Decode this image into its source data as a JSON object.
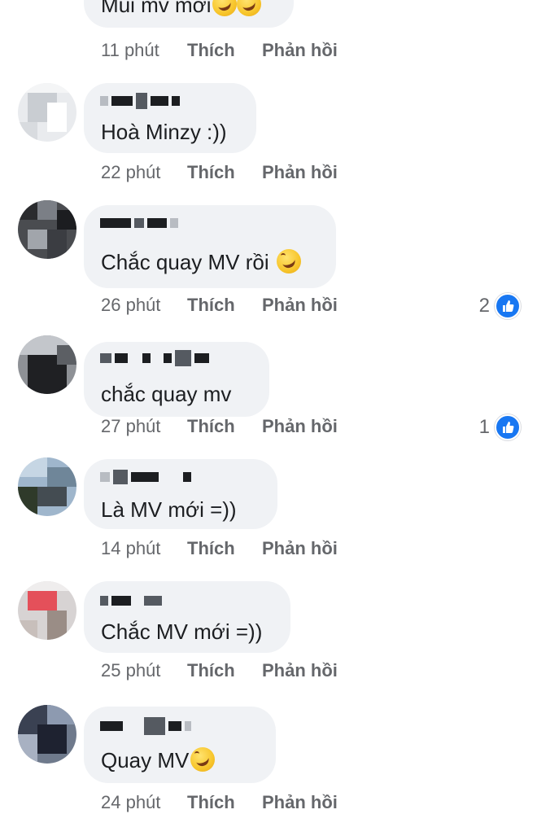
{
  "comments": [
    {
      "text": "Mùi mv mới",
      "emoji_count": 2,
      "time": "11 phút",
      "like": "Thích",
      "reply": "Phản hồi",
      "reactions": ""
    },
    {
      "text": "Hoà Minzy :))",
      "emoji_count": 0,
      "time": "22 phút",
      "like": "Thích",
      "reply": "Phản hồi",
      "reactions": ""
    },
    {
      "text": "Chắc quay MV rồi",
      "emoji_count": 1,
      "time": "26 phút",
      "like": "Thích",
      "reply": "Phản hồi",
      "reactions": "2"
    },
    {
      "text": "chắc quay mv",
      "emoji_count": 0,
      "time": "27 phút",
      "like": "Thích",
      "reply": "Phản hồi",
      "reactions": "1"
    },
    {
      "text": "Là MV mới =))",
      "emoji_count": 0,
      "time": "14 phút",
      "like": "Thích",
      "reply": "Phản hồi",
      "reactions": ""
    },
    {
      "text": "Chắc MV mới =))",
      "emoji_count": 0,
      "time": "25 phút",
      "like": "Thích",
      "reply": "Phản hồi",
      "reactions": ""
    },
    {
      "text": "Quay MV",
      "emoji_count": 1,
      "time": "24 phút",
      "like": "Thích",
      "reply": "Phản hồi",
      "reactions": ""
    }
  ],
  "colors": {
    "bubble": "#f0f2f5",
    "meta": "#65676b",
    "like_badge": "#1877f2"
  },
  "icons": {
    "emoji": "rolling-on-floor-laughing-emoji",
    "reaction": "like-thumbs-up-icon"
  }
}
